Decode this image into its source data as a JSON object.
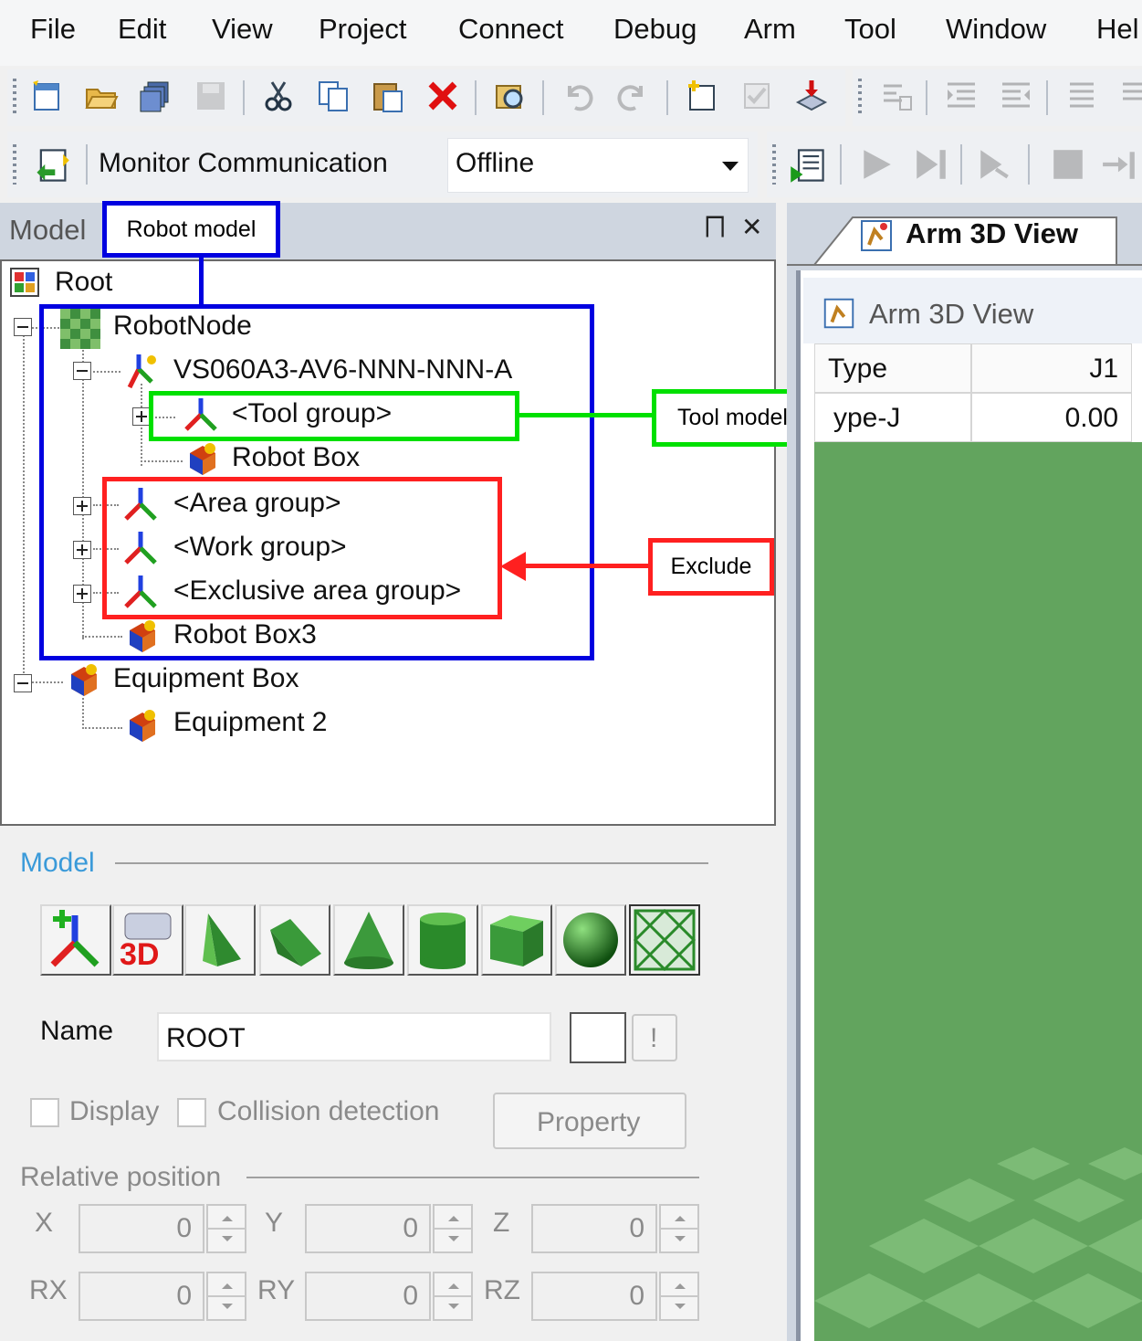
{
  "menu": {
    "items": [
      "File",
      "Edit",
      "View",
      "Project",
      "Connect",
      "Debug",
      "Arm",
      "Tool",
      "Window",
      "Hel"
    ]
  },
  "monitor_toolbar": {
    "label": "Monitor Communication",
    "combo_value": "Offline"
  },
  "model_panel": {
    "tab_label": "Model",
    "pin_glyph": "⨅",
    "close_glyph": "✕",
    "tree": {
      "root": "Root",
      "robot_node": "RobotNode",
      "robot": "VS060A3-AV6-NNN-NNN-A",
      "tool_group": "<Tool group>",
      "robot_box": "Robot Box",
      "area_group": "<Area group>",
      "work_group": "<Work group>",
      "exclusive_area_group": "<Exclusive area group>",
      "robot_box3": "Robot Box3",
      "equipment_box": "Equipment Box",
      "equipment2": "Equipment 2"
    }
  },
  "callouts": {
    "robot_model": "Robot model",
    "tool_model": "Tool model",
    "exclude": "Exclude",
    "colors": {
      "robot": "#0000e0",
      "tool": "#00e000",
      "exclude": "#ff2020"
    }
  },
  "properties": {
    "section_title": "Model",
    "name_label": "Name",
    "name_value": "ROOT",
    "warn_glyph": "!",
    "display_label": "Display",
    "collision_label": "Collision detection",
    "property_button": "Property",
    "relative_position_title": "Relative position",
    "fields": [
      {
        "label": "X",
        "value": "0"
      },
      {
        "label": "Y",
        "value": "0"
      },
      {
        "label": "Z",
        "value": "0"
      },
      {
        "label": "RX",
        "value": "0"
      },
      {
        "label": "RY",
        "value": "0"
      },
      {
        "label": "RZ",
        "value": "0"
      }
    ]
  },
  "arm_view": {
    "tab_label": "Arm 3D View",
    "inner_title": "Arm 3D View",
    "table": {
      "headers": [
        "Type",
        "J1"
      ],
      "row": [
        "ype-J",
        "0.00"
      ]
    },
    "viewport_color": "#62a45e"
  }
}
